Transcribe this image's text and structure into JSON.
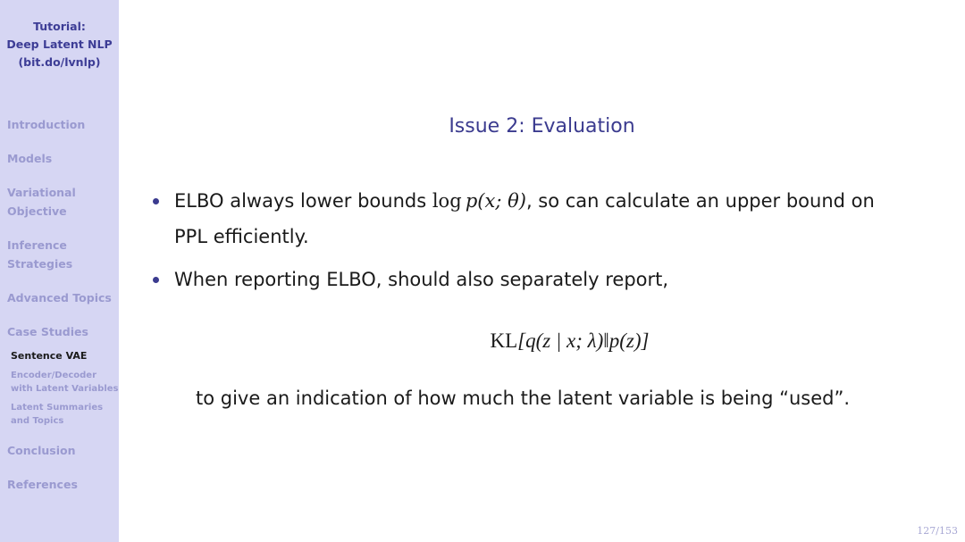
{
  "sidebar": {
    "title_lines": [
      "Tutorial:",
      "Deep Latent NLP",
      "(bit.do/lvnlp)"
    ],
    "sections": [
      {
        "label_lines": [
          "Introduction"
        ]
      },
      {
        "label_lines": [
          "Models"
        ]
      },
      {
        "label_lines": [
          "Variational",
          "Objective"
        ]
      },
      {
        "label_lines": [
          "Inference",
          "Strategies"
        ]
      },
      {
        "label_lines": [
          "Advanced Topics"
        ]
      },
      {
        "label_lines": [
          "Case Studies"
        ]
      },
      {
        "label_lines": [
          "Conclusion"
        ]
      },
      {
        "label_lines": [
          "References"
        ]
      }
    ],
    "subsections": [
      {
        "label_lines": [
          "Sentence VAE"
        ],
        "active": true
      },
      {
        "label_lines": [
          "Encoder/Decoder",
          "with Latent Variables"
        ],
        "active": false
      },
      {
        "label_lines": [
          "Latent Summaries",
          "and Topics"
        ],
        "active": false
      }
    ]
  },
  "slide": {
    "title": "Issue 2:  Evaluation",
    "bullets": [
      {
        "text_before_math": "ELBO always lower bounds ",
        "math": {
          "op": "log",
          "expr": "p(x; θ)"
        },
        "text_after_math": ", so can calculate an upper bound on",
        "line2": "PPL efficiently."
      },
      {
        "text": "When reporting ELBO, should also separately report,"
      }
    ],
    "display_math": {
      "op": "KL",
      "expr": "[q(z | x; λ)‖p(z)]"
    },
    "continuation": "to give an indication of how much the latent variable is being “used”."
  },
  "footer": {
    "page_number": "127/153"
  },
  "colors": {
    "sidebar_bg": "#d6d6f3",
    "title_blue": "#3b3b8f",
    "nav_inactive": "#9a9ad0",
    "nav_active": "#1a1a1a",
    "body_text": "#1a1a1a"
  }
}
